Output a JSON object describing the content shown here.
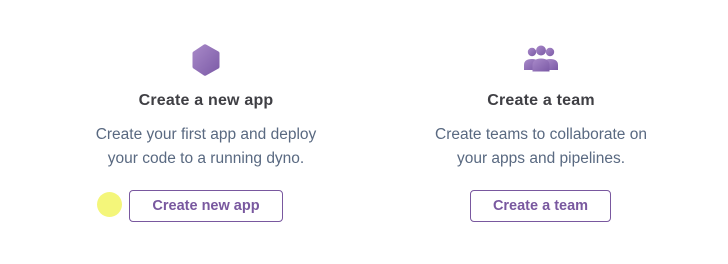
{
  "cards": [
    {
      "title": "Create a new app",
      "desc_line1": "Create your first app and deploy",
      "desc_line2": "your code to a running dyno.",
      "button_label": "Create new app",
      "icon": "hexagon-icon"
    },
    {
      "title": "Create a team",
      "desc_line1": "Create teams to collaborate on",
      "desc_line2": "your apps and pipelines.",
      "button_label": "Create a team",
      "icon": "team-icon"
    }
  ],
  "colors": {
    "accent": "#79589f",
    "icon_light": "#a98ac9",
    "icon_dark": "#7b5aa6",
    "title": "#3f3f44",
    "body": "#596981",
    "cursor_highlight": "#f3f56b"
  }
}
